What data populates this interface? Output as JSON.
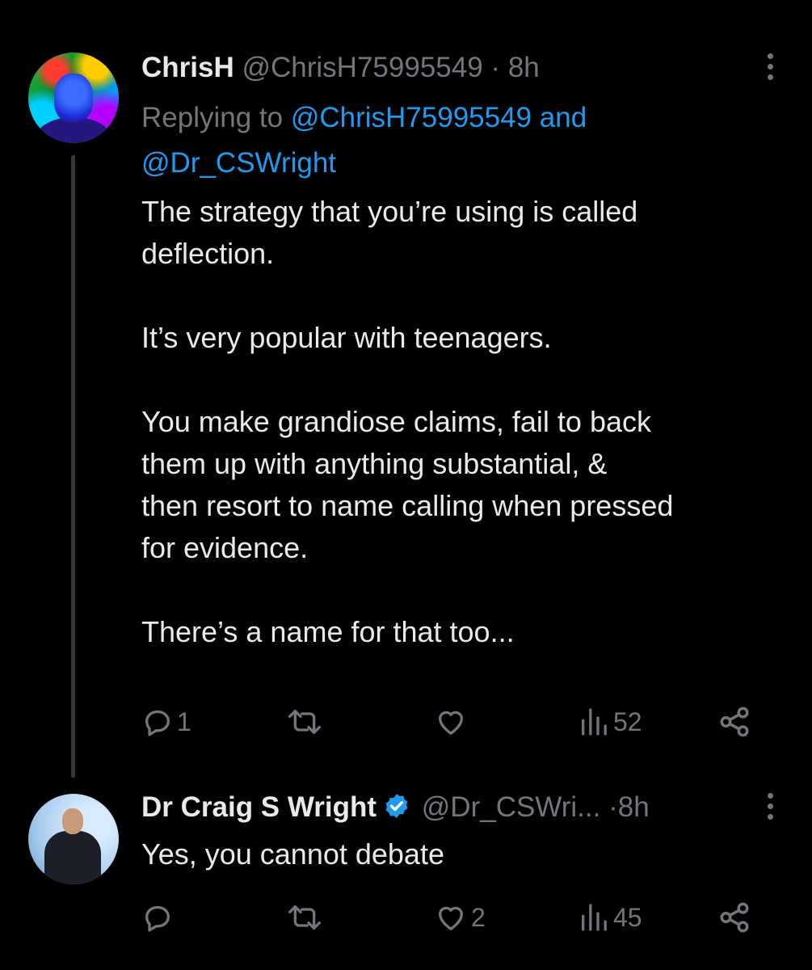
{
  "tweets": [
    {
      "display_name": "ChrisH",
      "handle": "@ChrisH75995549",
      "separator": "·",
      "time": "8h",
      "replying_prefix": "Replying to",
      "replying_mention_1": "@ChrisH75995549",
      "replying_and": "and",
      "replying_mention_2": "@Dr_CSWright",
      "paragraphs": [
        "The strategy that you’re using is called\ndeflection.",
        "It’s very popular with teenagers.",
        "You make grandiose claims, fail to back\nthem up with anything substantial, &\nthen resort to name calling when pressed\nfor evidence.",
        "There’s a name for that too..."
      ],
      "reply_count": "1",
      "retweet_count": "",
      "like_count": "",
      "view_count": "52"
    },
    {
      "display_name": "Dr Craig S Wright",
      "verified": true,
      "handle": "@Dr_CSWri...",
      "separator": "·",
      "time": "8h",
      "paragraphs": [
        "Yes, you cannot debate"
      ],
      "reply_count": "",
      "retweet_count": "",
      "like_count": "2",
      "view_count": "45"
    }
  ],
  "colors": {
    "background": "#000000",
    "text_primary": "#e7e9ea",
    "text_secondary": "#71767b",
    "accent_blue": "#1d9bf0",
    "thread_line": "#333639"
  },
  "icons": {
    "reply": "reply-icon",
    "retweet": "retweet-icon",
    "like": "heart-icon",
    "views": "analytics-icon",
    "share": "share-icon",
    "more": "more-icon",
    "verified": "verified-badge-icon"
  }
}
